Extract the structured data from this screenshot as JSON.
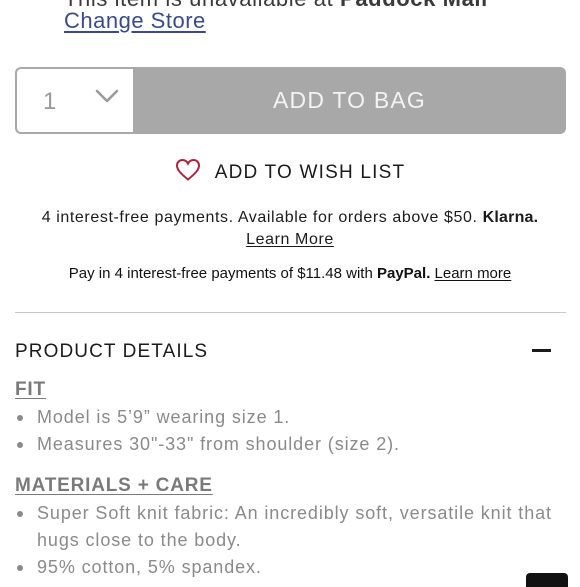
{
  "store": {
    "unavailable_prefix": "This item is unavailable at",
    "store_name": "Paddock Mall",
    "change_store_label": "Change Store"
  },
  "purchase": {
    "quantity_value": "1",
    "add_to_bag_label": "ADD TO BAG",
    "add_to_wish_list_label": "ADD TO WISH LIST"
  },
  "klarna": {
    "text": "4 interest-free payments. Available for orders above $50.",
    "brand": "Klarna.",
    "learn_more_label": "Learn More"
  },
  "paypal": {
    "text_prefix": "Pay in 4 interest-free payments of $11.48 with",
    "brand": "PayPal.",
    "learn_more_label": "Learn more"
  },
  "product_details": {
    "title": "PRODUCT DETAILS",
    "fit": {
      "heading": "FIT",
      "items": [
        "Model is 5’9” wearing size 1.",
        "Measures 30\"-33\" from shoulder (size 2)."
      ]
    },
    "materials": {
      "heading": "MATERIALS + CARE",
      "items": [
        "Super Soft knit fabric: An incredibly soft, versatile knit that hugs close to the body.",
        "95% cotton, 5% spandex."
      ]
    }
  },
  "colors": {
    "link_blue": "#3b4b8a",
    "button_gray": "#a8a8a8",
    "heart_red": "#b0213c",
    "muted_text": "#8a8a8a"
  }
}
